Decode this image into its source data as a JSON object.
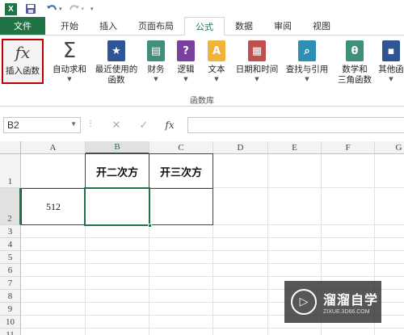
{
  "quick_access": {
    "app_icon_letter": "X"
  },
  "tabs": [
    {
      "label": "文件"
    },
    {
      "label": "开始"
    },
    {
      "label": "插入"
    },
    {
      "label": "页面布局"
    },
    {
      "label": "公式"
    },
    {
      "label": "数据"
    },
    {
      "label": "审阅"
    },
    {
      "label": "视图"
    }
  ],
  "ribbon": {
    "insert_function": {
      "symbol": "fx",
      "label": "插入函数"
    },
    "autosum": {
      "symbol": "Σ",
      "label": "自动求和"
    },
    "recent": {
      "label_line1": "最近使用的",
      "label_line2": "函数"
    },
    "financial": {
      "label": "财务"
    },
    "logical": {
      "symbol": "?",
      "label": "逻辑"
    },
    "text": {
      "symbol": "A",
      "label": "文本"
    },
    "datetime": {
      "label": "日期和时间"
    },
    "lookup": {
      "label": "查找与引用"
    },
    "math": {
      "symbol": "θ",
      "label_line1": "数学和",
      "label_line2": "三角函数"
    },
    "more": {
      "label": "其他函"
    },
    "group_label": "函数库"
  },
  "formula_bar": {
    "name_box": "B2",
    "fx_label": "fx",
    "formula": ""
  },
  "columns": [
    "A",
    "B",
    "C",
    "D",
    "E",
    "F",
    "G"
  ],
  "rows": [
    "1",
    "2",
    "3",
    "4",
    "5",
    "6",
    "7",
    "8",
    "9",
    "10",
    "11"
  ],
  "cells": {
    "B1": "开二次方",
    "C1": "开三次方",
    "A2": "512",
    "B2": "",
    "C2": ""
  },
  "watermark": {
    "title": "溜溜自学",
    "url": "ZIXUE.3D66.COM"
  },
  "colors": {
    "excel_green": "#217346",
    "highlight_red": "#c00000"
  }
}
